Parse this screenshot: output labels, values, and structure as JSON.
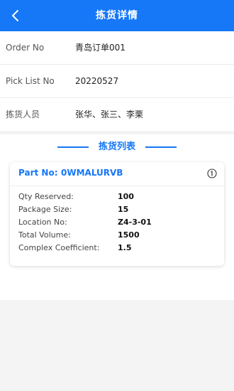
{
  "header": {
    "title": "拣货详情",
    "back_icon": "chevron-left-icon",
    "background": "#1677f7"
  },
  "info": {
    "rows": [
      {
        "label": "Order No",
        "value": "青岛订单001"
      },
      {
        "label": "Pick List No",
        "value": "20220527"
      },
      {
        "label": "拣货人员",
        "value": "张华、张三、李栗"
      }
    ]
  },
  "section": {
    "title": "拣货列表",
    "accent": "#1677f7"
  },
  "card": {
    "part_label": "Part No:",
    "part_value": "0WMALURVB",
    "info_icon": "info-circle-icon",
    "details": [
      {
        "label": "Qty Reserved:",
        "value": "100"
      },
      {
        "label": "Package Size:",
        "value": "15"
      },
      {
        "label": "Location No:",
        "value": "Z4-3-01"
      },
      {
        "label": "Total Volume:",
        "value": "1500"
      },
      {
        "label": "Complex Coefficient:",
        "value": "1.5"
      }
    ]
  }
}
